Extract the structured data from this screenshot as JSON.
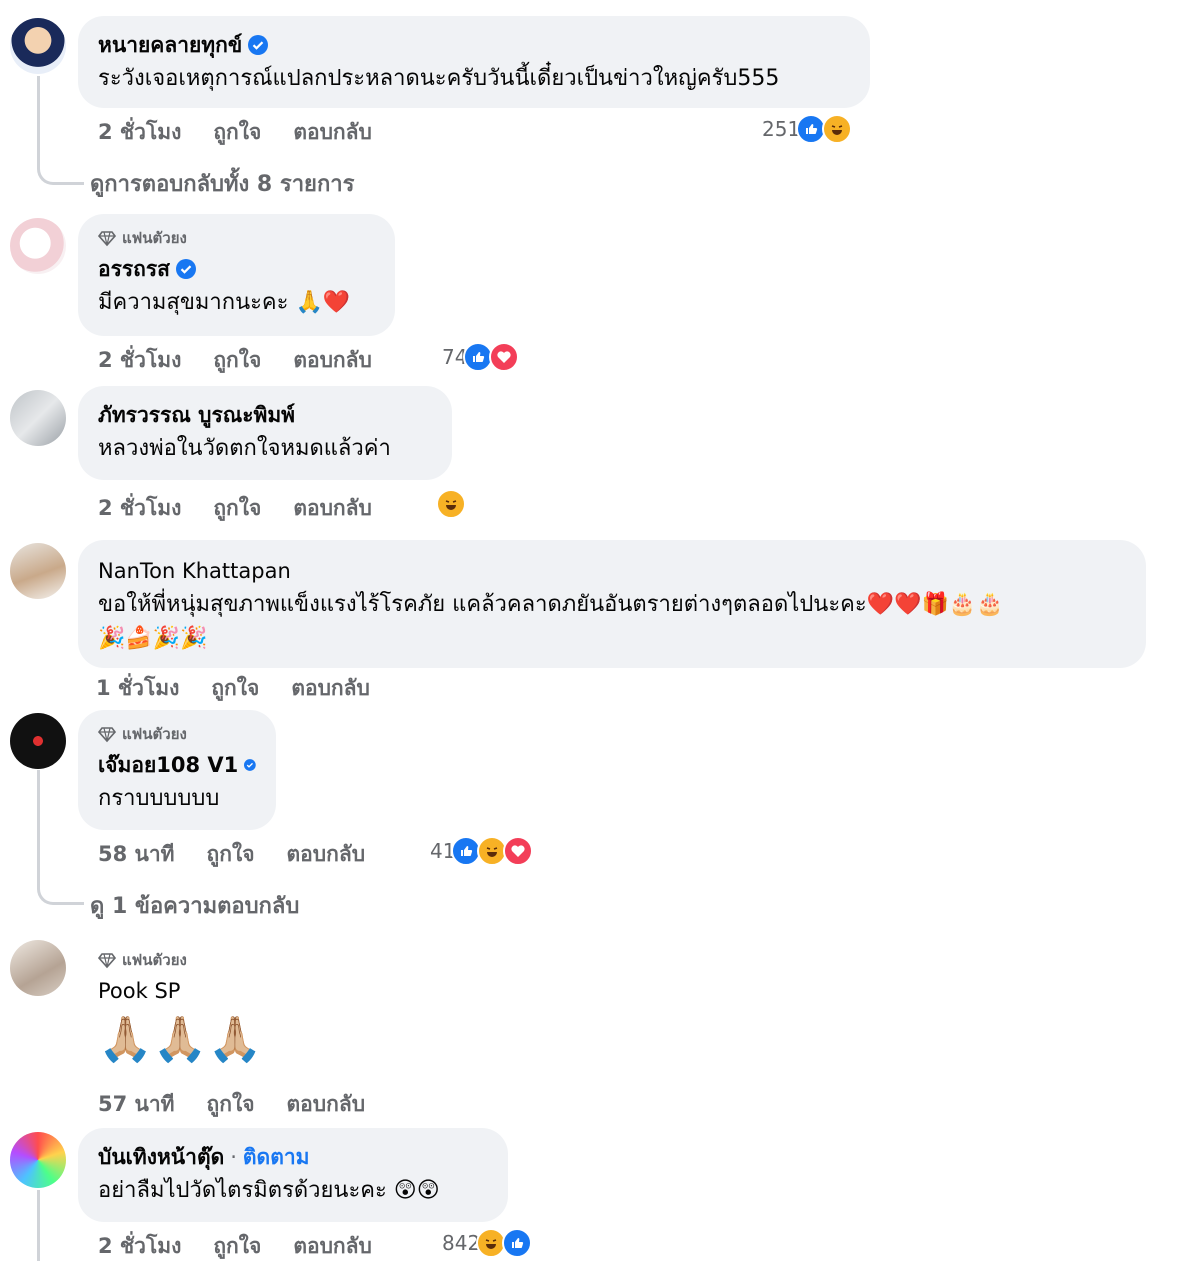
{
  "comments": [
    {
      "name": "หนายคลายทุกข์",
      "verified": true,
      "text": "ระวังเจอเหตุการณ์แปลกประหลาดนะครับวันนี้เดี๋ยวเป็นข่าวใหญ่ครับ555",
      "time": "2 ชั่วโมง",
      "like": "ถูกใจ",
      "reply": "ตอบกลับ",
      "reaction_count": "251",
      "reactions": [
        "like",
        "haha"
      ],
      "view_replies": "ดูการตอบกลับทั้ง 8 รายการ"
    },
    {
      "fan_badge": "แฟนตัวยง",
      "name": "อรรถรส",
      "verified": true,
      "text": "มีความสุขมากนะคะ 🙏❤️",
      "time": "2 ชั่วโมง",
      "like": "ถูกใจ",
      "reply": "ตอบกลับ",
      "reaction_count": "74",
      "reactions": [
        "like",
        "love"
      ]
    },
    {
      "name": "ภัทรวรรณ บูรณะพิมพ์",
      "text": "หลวงพ่อในวัดตกใจหมดแล้วค่า",
      "time": "2 ชั่วโมง",
      "like": "ถูกใจ",
      "reply": "ตอบกลับ",
      "reactions": [
        "haha"
      ]
    },
    {
      "name": "NanTon Khattapan",
      "text": "ขอให้พี่หนุ่มสุขภาพแข็งแรงไร้โรคภัย แคล้วคลาดภยันอันตรายต่างๆตลอดไปนะคะ❤️❤️🎁🎂🎂",
      "text2": "🎉🍰🎉🎉",
      "time": "1 ชั่วโมง",
      "like": "ถูกใจ",
      "reply": "ตอบกลับ"
    },
    {
      "fan_badge": "แฟนตัวยง",
      "name": "เจ๊มอย108 V1",
      "verified": true,
      "text": "กราบบบบบบ",
      "time": "58 นาที",
      "like": "ถูกใจ",
      "reply": "ตอบกลับ",
      "reaction_count": "41",
      "reactions": [
        "like",
        "haha",
        "love"
      ],
      "view_replies": "ดู 1 ข้อความตอบกลับ"
    },
    {
      "fan_badge": "แฟนตัวยง",
      "name": "Pook SP",
      "text": "🙏🏼🙏🏼🙏🏼",
      "time": "57 นาที",
      "like": "ถูกใจ",
      "reply": "ตอบกลับ"
    },
    {
      "name": "บันเทิงหน้าตุ๊ด",
      "follow": "ติดตาม",
      "text": "อย่าลืมไปวัดไตรมิตรด้วยนะคะ 😲😲",
      "time": "2 ชั่วโมง",
      "like": "ถูกใจ",
      "reply": "ตอบกลับ",
      "reaction_count": "842",
      "reactions": [
        "haha",
        "like"
      ]
    }
  ],
  "colors": {
    "bubble": "#f0f2f5",
    "meta": "#65676b",
    "verified": "#1877f2",
    "like": "#1877f2",
    "love": "#f33e58",
    "haha": "#f7b125"
  }
}
